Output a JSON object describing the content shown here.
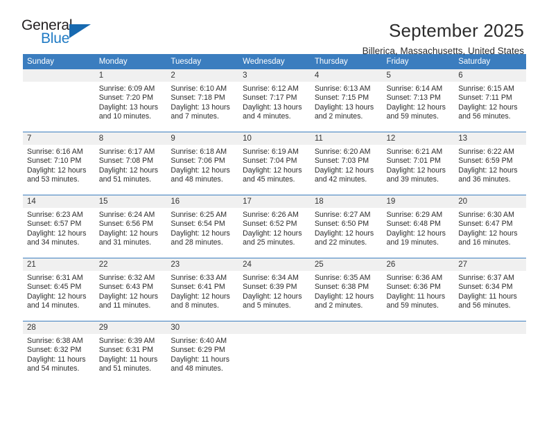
{
  "logo": {
    "word_top": "General",
    "word_bottom": "Blue",
    "triangle_color": "#1769b0",
    "blue": "#1f7ac4"
  },
  "header": {
    "month_title": "September 2025",
    "location": "Billerica, Massachusetts, United States"
  },
  "theme": {
    "header_blue": "#3b7dbf",
    "daynum_gray": "#f0f0f0"
  },
  "calendar": {
    "weekday_headers": [
      "Sunday",
      "Monday",
      "Tuesday",
      "Wednesday",
      "Thursday",
      "Friday",
      "Saturday"
    ],
    "weeks": [
      [
        {
          "day": "",
          "lines": []
        },
        {
          "day": "1",
          "lines": [
            "Sunrise: 6:09 AM",
            "Sunset: 7:20 PM",
            "Daylight: 13 hours",
            "and 10 minutes."
          ]
        },
        {
          "day": "2",
          "lines": [
            "Sunrise: 6:10 AM",
            "Sunset: 7:18 PM",
            "Daylight: 13 hours",
            "and 7 minutes."
          ]
        },
        {
          "day": "3",
          "lines": [
            "Sunrise: 6:12 AM",
            "Sunset: 7:17 PM",
            "Daylight: 13 hours",
            "and 4 minutes."
          ]
        },
        {
          "day": "4",
          "lines": [
            "Sunrise: 6:13 AM",
            "Sunset: 7:15 PM",
            "Daylight: 13 hours",
            "and 2 minutes."
          ]
        },
        {
          "day": "5",
          "lines": [
            "Sunrise: 6:14 AM",
            "Sunset: 7:13 PM",
            "Daylight: 12 hours",
            "and 59 minutes."
          ]
        },
        {
          "day": "6",
          "lines": [
            "Sunrise: 6:15 AM",
            "Sunset: 7:11 PM",
            "Daylight: 12 hours",
            "and 56 minutes."
          ]
        }
      ],
      [
        {
          "day": "7",
          "lines": [
            "Sunrise: 6:16 AM",
            "Sunset: 7:10 PM",
            "Daylight: 12 hours",
            "and 53 minutes."
          ]
        },
        {
          "day": "8",
          "lines": [
            "Sunrise: 6:17 AM",
            "Sunset: 7:08 PM",
            "Daylight: 12 hours",
            "and 51 minutes."
          ]
        },
        {
          "day": "9",
          "lines": [
            "Sunrise: 6:18 AM",
            "Sunset: 7:06 PM",
            "Daylight: 12 hours",
            "and 48 minutes."
          ]
        },
        {
          "day": "10",
          "lines": [
            "Sunrise: 6:19 AM",
            "Sunset: 7:04 PM",
            "Daylight: 12 hours",
            "and 45 minutes."
          ]
        },
        {
          "day": "11",
          "lines": [
            "Sunrise: 6:20 AM",
            "Sunset: 7:03 PM",
            "Daylight: 12 hours",
            "and 42 minutes."
          ]
        },
        {
          "day": "12",
          "lines": [
            "Sunrise: 6:21 AM",
            "Sunset: 7:01 PM",
            "Daylight: 12 hours",
            "and 39 minutes."
          ]
        },
        {
          "day": "13",
          "lines": [
            "Sunrise: 6:22 AM",
            "Sunset: 6:59 PM",
            "Daylight: 12 hours",
            "and 36 minutes."
          ]
        }
      ],
      [
        {
          "day": "14",
          "lines": [
            "Sunrise: 6:23 AM",
            "Sunset: 6:57 PM",
            "Daylight: 12 hours",
            "and 34 minutes."
          ]
        },
        {
          "day": "15",
          "lines": [
            "Sunrise: 6:24 AM",
            "Sunset: 6:56 PM",
            "Daylight: 12 hours",
            "and 31 minutes."
          ]
        },
        {
          "day": "16",
          "lines": [
            "Sunrise: 6:25 AM",
            "Sunset: 6:54 PM",
            "Daylight: 12 hours",
            "and 28 minutes."
          ]
        },
        {
          "day": "17",
          "lines": [
            "Sunrise: 6:26 AM",
            "Sunset: 6:52 PM",
            "Daylight: 12 hours",
            "and 25 minutes."
          ]
        },
        {
          "day": "18",
          "lines": [
            "Sunrise: 6:27 AM",
            "Sunset: 6:50 PM",
            "Daylight: 12 hours",
            "and 22 minutes."
          ]
        },
        {
          "day": "19",
          "lines": [
            "Sunrise: 6:29 AM",
            "Sunset: 6:48 PM",
            "Daylight: 12 hours",
            "and 19 minutes."
          ]
        },
        {
          "day": "20",
          "lines": [
            "Sunrise: 6:30 AM",
            "Sunset: 6:47 PM",
            "Daylight: 12 hours",
            "and 16 minutes."
          ]
        }
      ],
      [
        {
          "day": "21",
          "lines": [
            "Sunrise: 6:31 AM",
            "Sunset: 6:45 PM",
            "Daylight: 12 hours",
            "and 14 minutes."
          ]
        },
        {
          "day": "22",
          "lines": [
            "Sunrise: 6:32 AM",
            "Sunset: 6:43 PM",
            "Daylight: 12 hours",
            "and 11 minutes."
          ]
        },
        {
          "day": "23",
          "lines": [
            "Sunrise: 6:33 AM",
            "Sunset: 6:41 PM",
            "Daylight: 12 hours",
            "and 8 minutes."
          ]
        },
        {
          "day": "24",
          "lines": [
            "Sunrise: 6:34 AM",
            "Sunset: 6:39 PM",
            "Daylight: 12 hours",
            "and 5 minutes."
          ]
        },
        {
          "day": "25",
          "lines": [
            "Sunrise: 6:35 AM",
            "Sunset: 6:38 PM",
            "Daylight: 12 hours",
            "and 2 minutes."
          ]
        },
        {
          "day": "26",
          "lines": [
            "Sunrise: 6:36 AM",
            "Sunset: 6:36 PM",
            "Daylight: 11 hours",
            "and 59 minutes."
          ]
        },
        {
          "day": "27",
          "lines": [
            "Sunrise: 6:37 AM",
            "Sunset: 6:34 PM",
            "Daylight: 11 hours",
            "and 56 minutes."
          ]
        }
      ],
      [
        {
          "day": "28",
          "lines": [
            "Sunrise: 6:38 AM",
            "Sunset: 6:32 PM",
            "Daylight: 11 hours",
            "and 54 minutes."
          ]
        },
        {
          "day": "29",
          "lines": [
            "Sunrise: 6:39 AM",
            "Sunset: 6:31 PM",
            "Daylight: 11 hours",
            "and 51 minutes."
          ]
        },
        {
          "day": "30",
          "lines": [
            "Sunrise: 6:40 AM",
            "Sunset: 6:29 PM",
            "Daylight: 11 hours",
            "and 48 minutes."
          ]
        },
        {
          "day": "",
          "lines": []
        },
        {
          "day": "",
          "lines": []
        },
        {
          "day": "",
          "lines": []
        },
        {
          "day": "",
          "lines": []
        }
      ]
    ]
  }
}
